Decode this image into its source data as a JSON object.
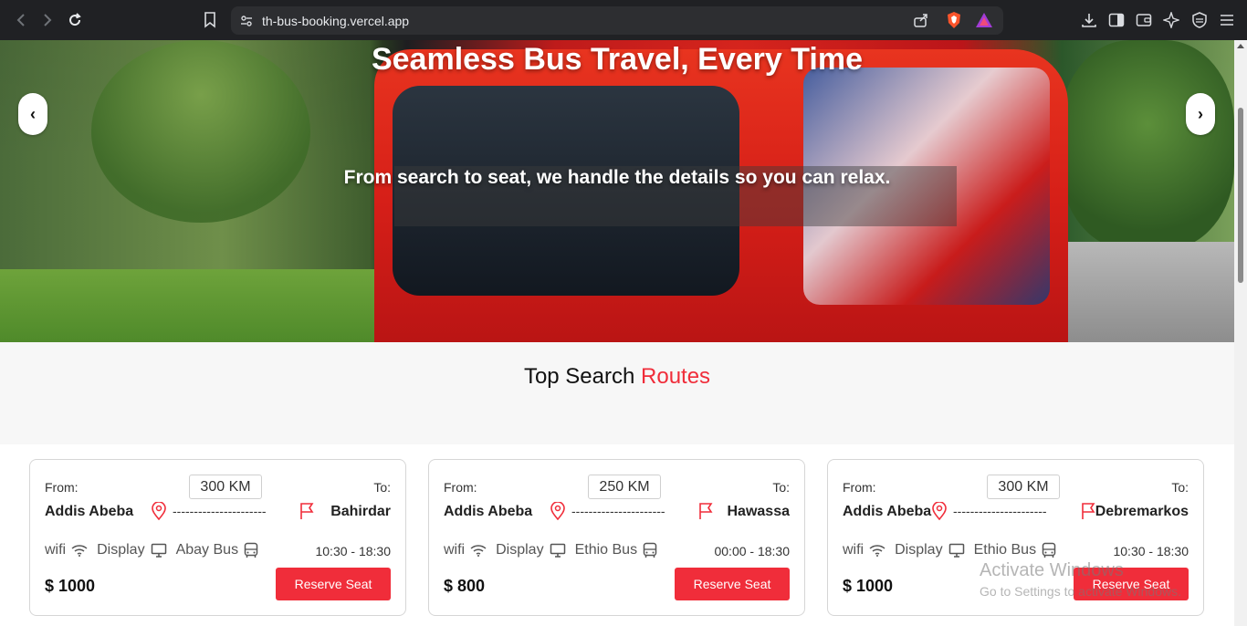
{
  "browser": {
    "url": "th-bus-booking.vercel.app"
  },
  "hero": {
    "title": "Seamless Bus Travel, Every Time",
    "subtitle": "From search to seat, we handle the details so you can relax.",
    "prev_label": "‹",
    "next_label": "›"
  },
  "section": {
    "title_part1": "Top Search ",
    "title_part2": "Routes",
    "accent_color": "#f02d3a"
  },
  "cards": [
    {
      "from_label": "From:",
      "to_label": "To:",
      "distance": "300 KM",
      "from_city": "Addis Abeba",
      "to_city": "Bahirdar",
      "dashes": "----------------------",
      "amenity1": "wifi",
      "amenity2": "Display",
      "operator": "Abay Bus",
      "time": "10:30 - 18:30",
      "price": "$ 1000",
      "reserve_label": "Reserve Seat"
    },
    {
      "from_label": "From:",
      "to_label": "To:",
      "distance": "250 KM",
      "from_city": "Addis Abeba",
      "to_city": "Hawassa",
      "dashes": "----------------------",
      "amenity1": "wifi",
      "amenity2": "Display",
      "operator": "Ethio Bus",
      "time": "00:00 - 18:30",
      "price": "$ 800",
      "reserve_label": "Reserve Seat"
    },
    {
      "from_label": "From:",
      "to_label": "To:",
      "distance": "300 KM",
      "from_city": "Addis Abeba",
      "to_city": "Debremarkos",
      "dashes": "----------------------",
      "amenity1": "wifi",
      "amenity2": "Display",
      "operator": "Ethio Bus",
      "time": "10:30 - 18:30",
      "price": "$ 1000",
      "reserve_label": "Reserve Seat"
    }
  ],
  "watermark": {
    "line1": "Activate Windows",
    "line2": "Go to Settings to activate Windows."
  },
  "icons": [
    "back-icon",
    "forward-icon",
    "reload-icon",
    "bookmark-icon",
    "site-settings-icon",
    "share-icon",
    "brave-shield-icon",
    "rewards-icon",
    "download-icon",
    "sidebar-icon",
    "wallet-icon",
    "leo-icon",
    "vpn-icon",
    "menu-icon",
    "location-pin-icon",
    "flag-icon",
    "wifi-icon",
    "display-icon",
    "bus-icon"
  ]
}
